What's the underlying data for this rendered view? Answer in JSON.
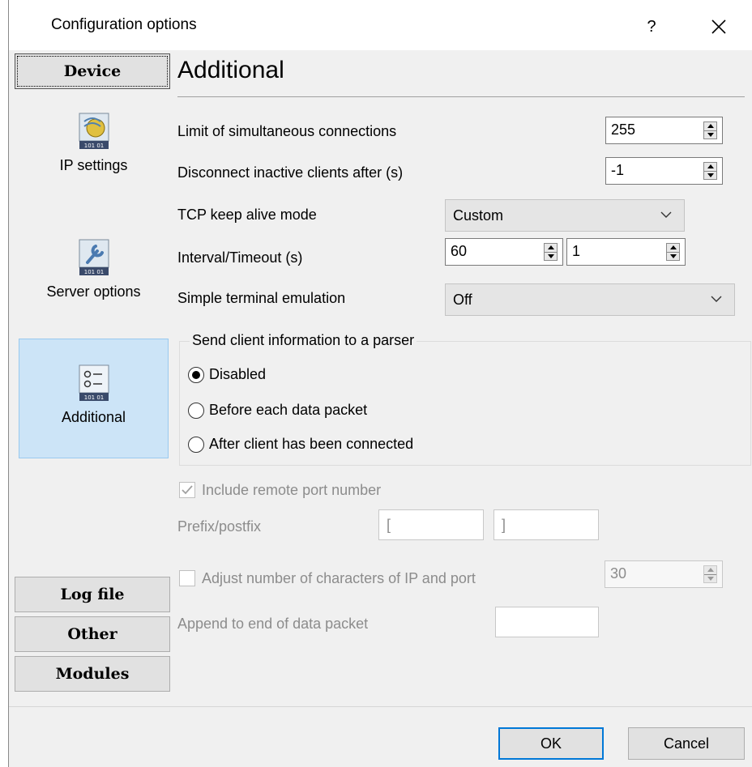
{
  "window": {
    "title": "Configuration options",
    "help_label": "?"
  },
  "sidebar": {
    "device_label": "Device",
    "items": [
      {
        "label": "IP settings",
        "icon": "network-settings-icon"
      },
      {
        "label": "Server options",
        "icon": "wrench-icon"
      },
      {
        "label": "Additional",
        "icon": "list-options-icon"
      }
    ],
    "icon_badge": "101 01",
    "bottom_buttons": [
      "Log file",
      "Other",
      "Modules"
    ]
  },
  "main": {
    "title": "Additional",
    "fields": {
      "limit_label": "Limit of simultaneous connections",
      "limit_value": "255",
      "disconnect_label": "Disconnect inactive clients after (s)",
      "disconnect_value": "-1",
      "keepalive_label": "TCP keep alive mode",
      "keepalive_value": "Custom",
      "interval_label": "Interval/Timeout (s)",
      "interval_value": "60",
      "timeout_value": "1",
      "terminal_label": "Simple terminal emulation",
      "terminal_value": "Off"
    },
    "parser_group": {
      "title": "Send client information to a parser",
      "options": [
        "Disabled",
        "Before each data packet",
        "After client has been connected"
      ],
      "selected": "Disabled"
    },
    "include_port_label": "Include remote port number",
    "include_port_checked": true,
    "prefix_label": "Prefix/postfix",
    "prefix_value": "[",
    "postfix_value": "]",
    "adjust_label": "Adjust number of characters of IP and port",
    "adjust_checked": false,
    "adjust_value": "30",
    "append_label": "Append to end of data packet",
    "append_value": ""
  },
  "footer": {
    "ok_label": "OK",
    "cancel_label": "Cancel"
  },
  "colors": {
    "window_bg": "#f0f0f0",
    "selected_item_bg": "#cce4f7",
    "primary_border": "#0078d7",
    "disabled_text": "#8c8c8c"
  }
}
